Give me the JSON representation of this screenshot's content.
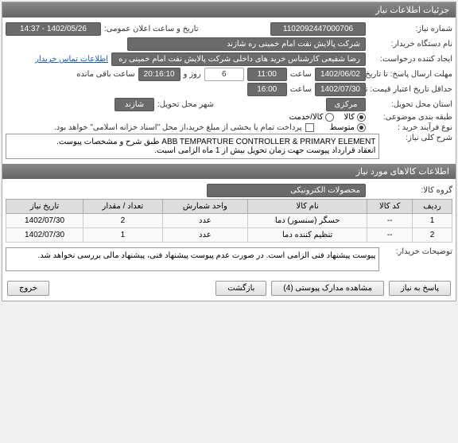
{
  "main": {
    "title": "جزئیات اطلاعات نیاز"
  },
  "info": {
    "reqNoLabel": "شماره نیاز:",
    "reqNo": "1102092447000706",
    "announceLabel": "تاریخ و ساعت اعلان عمومی:",
    "announceVal": "1402/05/26 - 14:37",
    "buyerLabel": "نام دستگاه خریدار:",
    "buyerVal": "شرکت پالایش نفت امام خمینی  ره  شازند",
    "creatorLabel": "ایجاد کننده درخواست:",
    "creatorVal": "رضا  شفیعی  کارشناس خرید های داخلی  شرکت پالایش نفت امام خمینی  ره",
    "contactLink": "اطلاعات تماس خریدار",
    "deadlineLabel": "مهلت ارسال پاسخ: تا تاریخ:",
    "deadlineDate": "1402/06/02",
    "timeLabel": "ساعت",
    "deadlineTime": "11:00",
    "daysLeft": "6",
    "daysAndLabel": "روز و",
    "timeLeft": "20:16:10",
    "timeLeftLabel": "ساعت باقی مانده",
    "priceValidLabel": "حداقل تاریخ اعتبار قیمت: تا تاریخ:",
    "priceValidDate": "1402/07/30",
    "priceValidTime": "16:00",
    "deliveryProvLabel": "استان محل تحویل:",
    "deliveryProv": "مرکزی",
    "deliveryCityLabel": "شهر محل تحویل:",
    "deliveryCity": "شازند",
    "categoryLabel": "طبقه بندی موضوعی:",
    "catGoods": "کالا",
    "catService": "کالا/خدمت",
    "processLabel": "نوع فرآیند خرید :",
    "procMedium": "متوسط",
    "payNote": "پرداخت تمام یا بخشی از مبلغ خرید،از محل \"اسناد خزانه اسلامی\" خواهد بود.",
    "descLabel": "شرح کلی نیاز:",
    "descVal": "ABB TEMPARTURE CONTROLLER & PRIMARY ELEMENT طبق شرح و مشخصات پیوست.\nانعقاد قرارداد پیوست جهت زمان تحویل بیش از 1 ماه الزامی اسبت."
  },
  "items": {
    "header": "اطلاعات کالاهای مورد نیاز",
    "groupLabel": "گروه کالا:",
    "groupVal": "محصولات الکترونیکی",
    "cols": {
      "row": "ردیف",
      "code": "کد کالا",
      "name": "نام کالا",
      "unit": "واحد شمارش",
      "qty": "تعداد / مقدار",
      "date": "تاریخ نیاز"
    },
    "rows": [
      {
        "row": "1",
        "code": "--",
        "name": "حسگر (سنسور) دما",
        "unit": "عدد",
        "qty": "2",
        "date": "1402/07/30"
      },
      {
        "row": "2",
        "code": "--",
        "name": "تنظیم کننده دما",
        "unit": "عدد",
        "qty": "1",
        "date": "1402/07/30"
      }
    ],
    "buyerNotesLabel": "توضیحات خریدار:",
    "buyerNotes": "پیوست پیشنهاد فنی الزامی است. در صورت عدم پیوست پیشنهاد فنی، پیشنهاد مالی بررسی نخواهد شد."
  },
  "footer": {
    "reply": "پاسخ به نیاز",
    "attach": "مشاهده مدارک پیوستی (4)",
    "back": "بازگشت",
    "exit": "خروج"
  }
}
